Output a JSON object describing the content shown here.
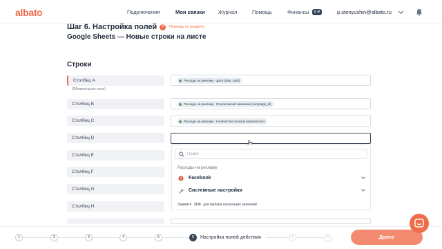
{
  "header": {
    "logo": "albato",
    "nav": [
      "Подключения",
      "Мои связки",
      "Журнал",
      "Помощь"
    ],
    "finance_label": "Финансы",
    "finance_badge": "0 ₽",
    "email": "p.stenyushin@albato.ru"
  },
  "page": {
    "title": "Шаг 6. Настройка полей",
    "help_badge": "?",
    "help_text": "Помощь по разделу",
    "subtitle": "Google Sheets — Новые строки на листе",
    "section": "Строки"
  },
  "rows": [
    {
      "label": "Столбец A",
      "chip": "Расходы на рекламу - Дата (date_start)",
      "note": "(Обязательное поле)"
    },
    {
      "label": "Столбец B",
      "chip": "Расходы на рекламу - ID рекламной кампании (campaign_id)"
    },
    {
      "label": "Столбец C",
      "chip": "Расходы на рекламу - Количество показов (impressions)"
    },
    {
      "label": "Столбец D",
      "chip": ""
    },
    {
      "label": "Столбец E"
    },
    {
      "label": "Столбец F"
    },
    {
      "label": "Столбец G"
    },
    {
      "label": "Столбец H"
    }
  ],
  "dropdown": {
    "search_placeholder": "Поиск",
    "group_label": "Расходы на рекламу",
    "options": [
      "Facebook",
      "Системные настройки"
    ],
    "hint_prefix": "Зажмите",
    "hint_key": "Shift",
    "hint_suffix": "для выбора нескольких значений"
  },
  "footer": {
    "steps": [
      "1",
      "2",
      "3",
      "4",
      "5",
      "6",
      "7",
      "8"
    ],
    "active_step_label": "Настройка полей действия",
    "next_label": "Далее"
  },
  "colors": {
    "accent": "#ef6c4a",
    "dark": "#3a4656"
  }
}
